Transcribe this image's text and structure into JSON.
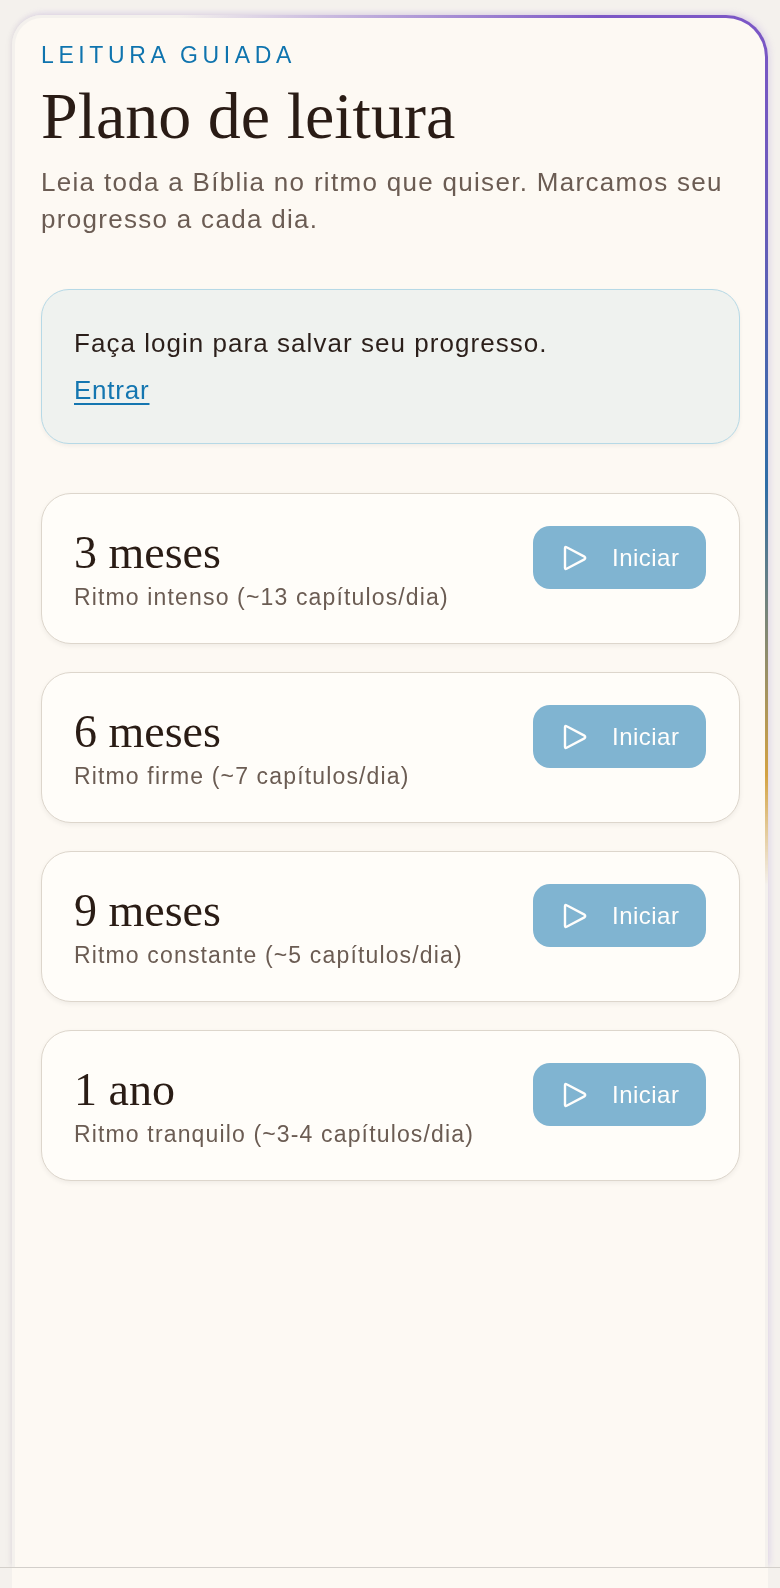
{
  "header": {
    "eyebrow": "LEITURA GUIADA",
    "title": "Plano de leitura",
    "subtitle": "Leia toda a Bíblia no ritmo que quiser. Marcamos seu progresso a cada dia."
  },
  "login_notice": {
    "message": "Faça login para salvar seu progresso.",
    "link": "Entrar"
  },
  "plans": [
    {
      "title": "3 meses",
      "description": "Ritmo intenso (~13 capítulos/dia)",
      "button": {
        "label": "Iniciar",
        "disabled": true
      }
    },
    {
      "title": "6 meses",
      "description": "Ritmo firme (~7 capítulos/dia)",
      "button": {
        "label": "Iniciar",
        "disabled": true
      }
    },
    {
      "title": "9 meses",
      "description": "Ritmo constante (~5 capítulos/dia)",
      "button": {
        "label": "Iniciar",
        "disabled": true
      }
    },
    {
      "title": "1 ano",
      "description": "Ritmo tranquilo (~3-4 capítulos/dia)",
      "button": {
        "label": "Iniciar",
        "disabled": true
      }
    }
  ]
}
